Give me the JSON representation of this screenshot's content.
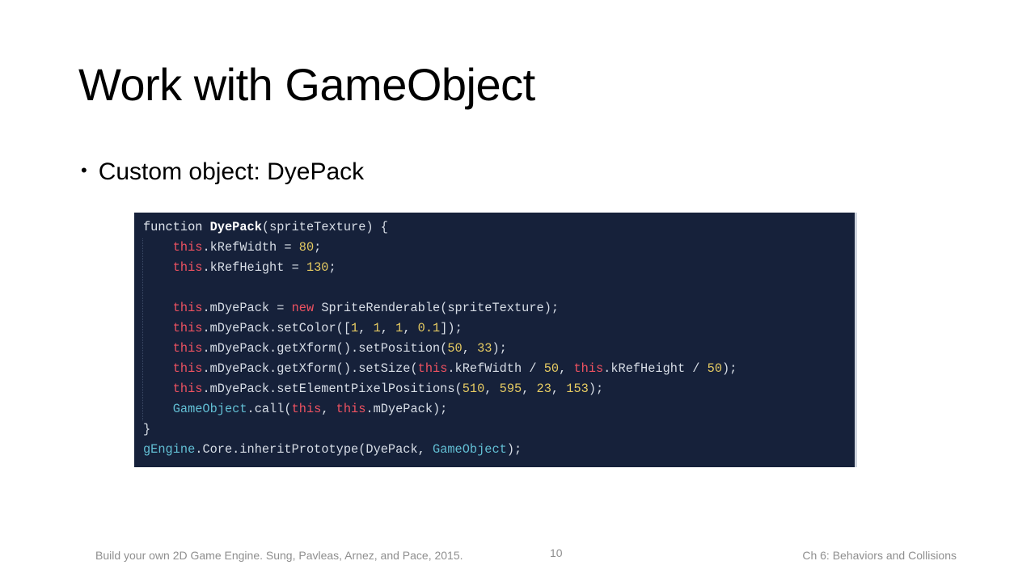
{
  "slide": {
    "title": "Work with GameObject",
    "bullet": "Custom object: DyePack"
  },
  "code": {
    "lines": [
      [
        {
          "t": "function ",
          "c": "kw"
        },
        {
          "t": "DyePack",
          "c": "fn"
        },
        {
          "t": "(spriteTexture) {",
          "c": "plain"
        }
      ],
      [
        {
          "t": "    ",
          "c": "plain"
        },
        {
          "t": "this",
          "c": "this"
        },
        {
          "t": ".kRefWidth = ",
          "c": "plain"
        },
        {
          "t": "80",
          "c": "num"
        },
        {
          "t": ";",
          "c": "plain"
        }
      ],
      [
        {
          "t": "    ",
          "c": "plain"
        },
        {
          "t": "this",
          "c": "this"
        },
        {
          "t": ".kRefHeight = ",
          "c": "plain"
        },
        {
          "t": "130",
          "c": "num"
        },
        {
          "t": ";",
          "c": "plain"
        }
      ],
      [
        {
          "t": "",
          "c": "plain"
        }
      ],
      [
        {
          "t": "    ",
          "c": "plain"
        },
        {
          "t": "this",
          "c": "this"
        },
        {
          "t": ".mDyePack = ",
          "c": "plain"
        },
        {
          "t": "new",
          "c": "this"
        },
        {
          "t": " SpriteRenderable(spriteTexture);",
          "c": "plain"
        }
      ],
      [
        {
          "t": "    ",
          "c": "plain"
        },
        {
          "t": "this",
          "c": "this"
        },
        {
          "t": ".mDyePack.setColor([",
          "c": "plain"
        },
        {
          "t": "1",
          "c": "num"
        },
        {
          "t": ", ",
          "c": "plain"
        },
        {
          "t": "1",
          "c": "num"
        },
        {
          "t": ", ",
          "c": "plain"
        },
        {
          "t": "1",
          "c": "num"
        },
        {
          "t": ", ",
          "c": "plain"
        },
        {
          "t": "0.1",
          "c": "num"
        },
        {
          "t": "]);",
          "c": "plain"
        }
      ],
      [
        {
          "t": "    ",
          "c": "plain"
        },
        {
          "t": "this",
          "c": "this"
        },
        {
          "t": ".mDyePack.getXform().setPosition(",
          "c": "plain"
        },
        {
          "t": "50",
          "c": "num"
        },
        {
          "t": ", ",
          "c": "plain"
        },
        {
          "t": "33",
          "c": "num"
        },
        {
          "t": ");",
          "c": "plain"
        }
      ],
      [
        {
          "t": "    ",
          "c": "plain"
        },
        {
          "t": "this",
          "c": "this"
        },
        {
          "t": ".mDyePack.getXform().setSize(",
          "c": "plain"
        },
        {
          "t": "this",
          "c": "this"
        },
        {
          "t": ".kRefWidth / ",
          "c": "plain"
        },
        {
          "t": "50",
          "c": "num"
        },
        {
          "t": ", ",
          "c": "plain"
        },
        {
          "t": "this",
          "c": "this"
        },
        {
          "t": ".kRefHeight / ",
          "c": "plain"
        },
        {
          "t": "50",
          "c": "num"
        },
        {
          "t": ");",
          "c": "plain"
        }
      ],
      [
        {
          "t": "    ",
          "c": "plain"
        },
        {
          "t": "this",
          "c": "this"
        },
        {
          "t": ".mDyePack.setElementPixelPositions(",
          "c": "plain"
        },
        {
          "t": "510",
          "c": "num"
        },
        {
          "t": ", ",
          "c": "plain"
        },
        {
          "t": "595",
          "c": "num"
        },
        {
          "t": ", ",
          "c": "plain"
        },
        {
          "t": "23",
          "c": "num"
        },
        {
          "t": ", ",
          "c": "plain"
        },
        {
          "t": "153",
          "c": "num"
        },
        {
          "t": ");",
          "c": "plain"
        }
      ],
      [
        {
          "t": "    ",
          "c": "plain"
        },
        {
          "t": "GameObject",
          "c": "cls"
        },
        {
          "t": ".call(",
          "c": "plain"
        },
        {
          "t": "this",
          "c": "this"
        },
        {
          "t": ", ",
          "c": "plain"
        },
        {
          "t": "this",
          "c": "this"
        },
        {
          "t": ".mDyePack);",
          "c": "plain"
        }
      ],
      [
        {
          "t": "}",
          "c": "plain"
        }
      ],
      [
        {
          "t": "gEngine",
          "c": "cls"
        },
        {
          "t": ".Core.inheritPrototype(DyePack, ",
          "c": "plain"
        },
        {
          "t": "GameObject",
          "c": "cls"
        },
        {
          "t": ");",
          "c": "plain"
        }
      ]
    ]
  },
  "footer": {
    "left": "Build your own 2D Game Engine. Sung, Pavleas, Arnez, and Pace, 2015.",
    "page_number": "10",
    "right": "Ch 6: Behaviors and Collisions"
  }
}
